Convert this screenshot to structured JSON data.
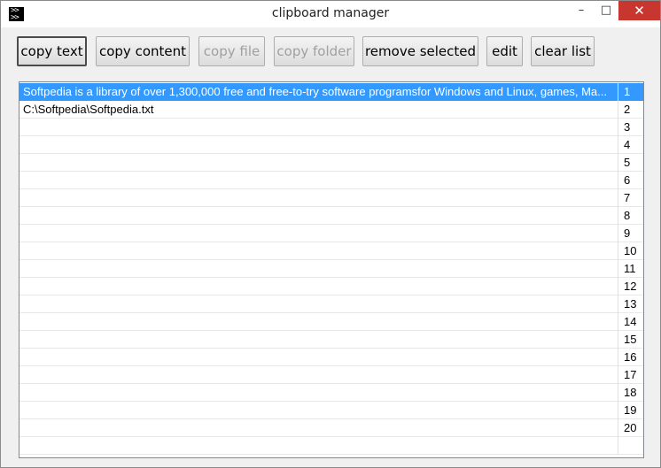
{
  "window": {
    "title": "clipboard manager",
    "min_glyph": "–",
    "max_glyph": "□",
    "close_glyph": "✕"
  },
  "toolbar": {
    "copy_text": "copy text",
    "copy_content": "copy content",
    "copy_file": "copy file",
    "copy_folder": "copy folder",
    "remove_selected": "remove selected",
    "edit": "edit",
    "clear_list": "clear list"
  },
  "list": {
    "selection_color": "#3399ff",
    "items": [
      {
        "text": "Softpedia is a library of over 1,300,000 free and free-to-try software programsfor Windows and Linux, games, Ma...",
        "index": "1",
        "selected": true
      },
      {
        "text": "C:\\Softpedia\\Softpedia.txt",
        "index": "2"
      },
      {
        "text": "",
        "index": "3"
      },
      {
        "text": "",
        "index": "4"
      },
      {
        "text": "",
        "index": "5"
      },
      {
        "text": "",
        "index": "6"
      },
      {
        "text": "",
        "index": "7"
      },
      {
        "text": "",
        "index": "8"
      },
      {
        "text": "",
        "index": "9"
      },
      {
        "text": "",
        "index": "10"
      },
      {
        "text": "",
        "index": "11"
      },
      {
        "text": "",
        "index": "12"
      },
      {
        "text": "",
        "index": "13"
      },
      {
        "text": "",
        "index": "14"
      },
      {
        "text": "",
        "index": "15"
      },
      {
        "text": "",
        "index": "16"
      },
      {
        "text": "",
        "index": "17"
      },
      {
        "text": "",
        "index": "18"
      },
      {
        "text": "",
        "index": "19"
      },
      {
        "text": "",
        "index": "20"
      },
      {
        "text": "",
        "index": ""
      }
    ]
  }
}
